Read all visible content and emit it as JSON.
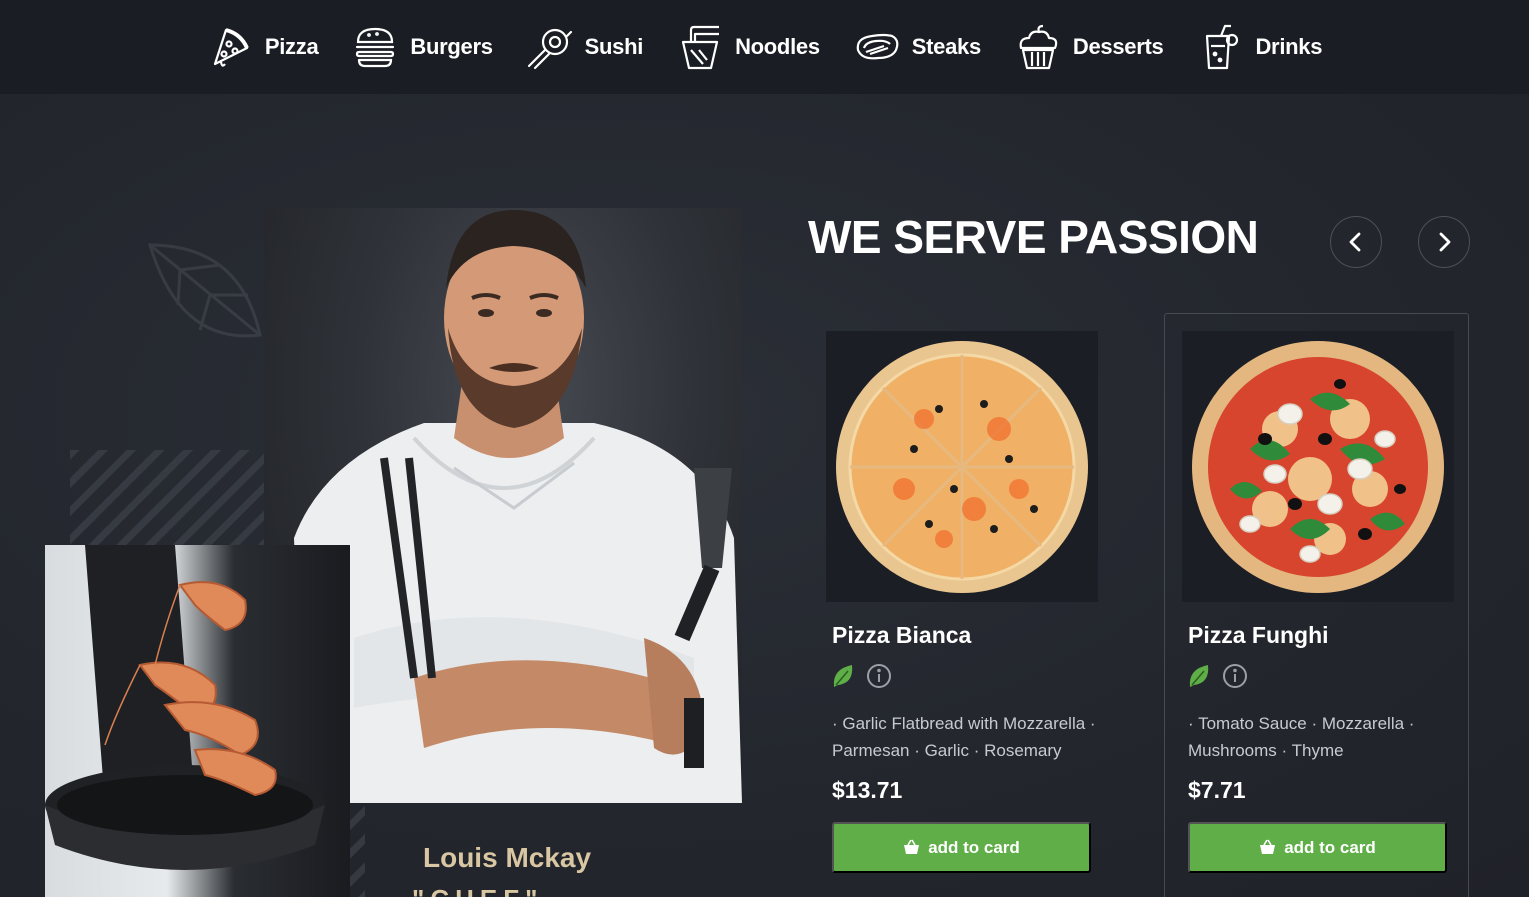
{
  "nav": {
    "items": [
      {
        "label": "Pizza",
        "icon": "pizza-icon"
      },
      {
        "label": "Burgers",
        "icon": "burger-icon"
      },
      {
        "label": "Sushi",
        "icon": "sushi-icon"
      },
      {
        "label": "Noodles",
        "icon": "noodles-icon"
      },
      {
        "label": "Steaks",
        "icon": "steak-icon"
      },
      {
        "label": "Desserts",
        "icon": "cupcake-icon"
      },
      {
        "label": "Drinks",
        "icon": "drink-icon"
      }
    ]
  },
  "hero": {
    "chef_name": "Louis Mckay",
    "chef_role": "\"CHEF\""
  },
  "menu": {
    "title": "WE SERVE PASSION",
    "prev_icon": "chevron-left-icon",
    "next_icon": "chevron-right-icon",
    "cards": [
      {
        "title": "Pizza Bianca",
        "description": "· Garlic Flatbread with Mozzarella · Parmesan · Garlic · Rosemary",
        "price": "$13.71",
        "button": "add to card"
      },
      {
        "title": "Pizza Funghi",
        "description": "· Tomato Sauce · Mozzarella · Mushrooms · Thyme",
        "price": "$7.71",
        "button": "add to card"
      }
    ]
  },
  "colors": {
    "accent": "#5fae48",
    "nav_bg": "#1a1d23",
    "page_bg": "#22252d",
    "chef_name": "#d9c6a2"
  }
}
